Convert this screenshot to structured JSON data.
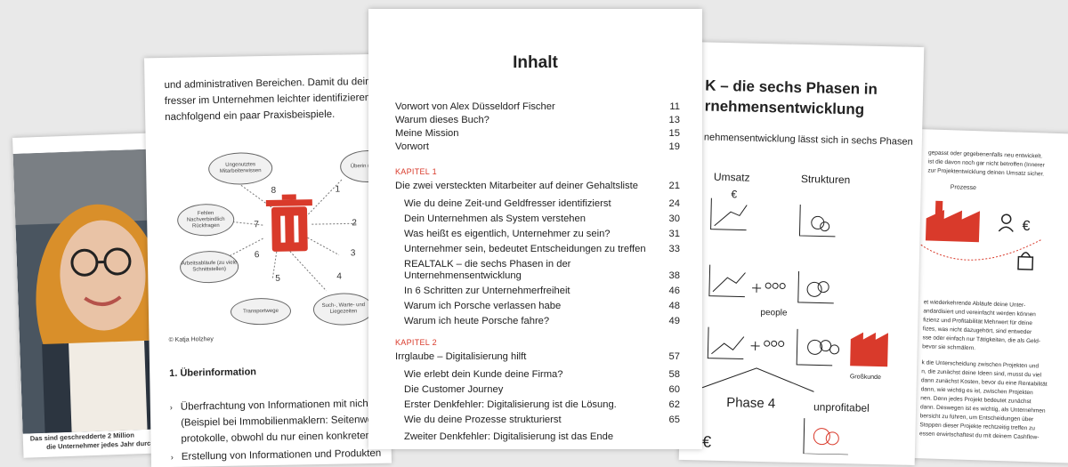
{
  "page1": {
    "caption_line1": "Das sind geschredderte 2 Million",
    "caption_line2": "die Unternehmer jedes Jahr durch"
  },
  "page2": {
    "intro_lines": [
      "und administrativen Bereichen. Damit du dein",
      "fresser im Unternehmen leichter identifizieren",
      "nachfolgend ein paar Praxisbeispiele."
    ],
    "credit": "© Katja Holzhey",
    "section_heading": "1. Überinformation",
    "bullet1_lines": [
      "Überfrachtung von Informationen mit nicht b",
      "(Beispiel bei Immobilienmaklern: Seitenweis",
      "protokolle, obwohl du nur einen konkreten B"
    ],
    "bullet2": "Erstellung von Informationen und Produkten",
    "diagram_numbers": [
      "1",
      "2",
      "3",
      "4",
      "5",
      "6",
      "7",
      "8"
    ],
    "ovals": [
      "Ungenutztes Mitarbeiterwissen",
      "Überin (z.B. gr",
      "Fehlen Nachverbindlich Rückfragen",
      "Arbeitsabläufe (zu viele Schnittstellen)",
      "Transportwege",
      "Such-, Warte- und Liegezeiten"
    ]
  },
  "toc": {
    "title": "Inhalt",
    "front": [
      {
        "label": "Vorwort von Alex Düsseldorf Fischer",
        "page": "11"
      },
      {
        "label": "Warum dieses Buch?",
        "page": "13"
      },
      {
        "label": "Meine Mission",
        "page": "15"
      },
      {
        "label": "Vorwort",
        "page": "19"
      }
    ],
    "k1_label": "KAPITEL 1",
    "k1_title": {
      "label": "Die zwei versteckten Mitarbeiter auf deiner Gehaltsliste",
      "page": "21"
    },
    "k1_items": [
      {
        "label": "Wie du deine Zeit-und Geldfresser identifizierst",
        "page": "24"
      },
      {
        "label": "Dein Unternehmen als System verstehen",
        "page": "30"
      },
      {
        "label": "Was heißt es eigentlich, Unternehmer zu sein?",
        "page": "31"
      },
      {
        "label": "Unternehmer sein, bedeutet Entscheidungen zu treffen",
        "page": "33"
      },
      {
        "label": "REALTALK – die sechs Phasen in der",
        "page": ""
      },
      {
        "label": "Unternehmensentwicklung",
        "page": "38"
      },
      {
        "label": "In 6 Schritten zur Unternehmerfreiheit",
        "page": "46"
      },
      {
        "label": "Warum ich Porsche verlassen habe",
        "page": "48"
      },
      {
        "label": "Warum ich heute Porsche fahre?",
        "page": "49"
      }
    ],
    "k2_label": "KAPITEL 2",
    "k2_title": {
      "label": "Irrglaube – Digitalisierung hilft",
      "page": "57"
    },
    "k2_items": [
      {
        "label": "Wie erlebt dein Kunde deine Firma?",
        "page": "58"
      },
      {
        "label": "Die Customer Journey",
        "page": "60"
      },
      {
        "label": "Erster Denkfehler: Digitalisierung ist die Lösung.",
        "page": "62"
      },
      {
        "label": "Wie du deine Prozesse strukturierst",
        "page": "65"
      },
      {
        "label": "Zweiter Denkfehler: Digitalisierung ist das Ende",
        "page": ""
      }
    ]
  },
  "page4": {
    "heading_line1": "K – die sechs Phasen in",
    "heading_line2": "rnehmensentwicklung",
    "subtext": "nehmensentwicklung lässt sich in sechs Phasen",
    "labels": {
      "umsatz": "Umsatz",
      "strukturen": "Strukturen",
      "people": "people",
      "phase": "Phase 4",
      "unprofitabel": "unprofitabel",
      "grosskunde": "Großkunde",
      "euro": "€"
    }
  },
  "page5": {
    "top_lines": [
      "gepasst oder gegebenenfalls neu entwickelt.",
      "ist die davon noch gar nicht betroffen (Innerer",
      "zur Projektentwicklung deinen Umsatz sicher."
    ],
    "prozesse": "Prozesse",
    "mid_lines": [
      "et wiederkehrende Abläufe deine Unter-",
      "andardisiert und vereinfacht werden können",
      "fizienz und Profitabilität Mehrwert für deine",
      "fizes, was nicht dazugehört, sind entweder",
      "sse oder einfach nur Tätigkeiten, die als Geld-",
      "bevor sie schmälern."
    ],
    "bottom_lines": [
      "k die Unterscheidung zwischen Projekten und",
      "n, die zunächst deine Ideen sind, musst du viel",
      "dann zunächst Kosten, bevor du eine Rentabilität",
      "dann, wie wichtig es ist, zwischen Projekten",
      "nen. Denn jedes Projekt bedeutet zunächst",
      "dann. Deswegen ist es wichtig, als Unternehmen",
      "bersicht zu führen, um Entscheidungen über",
      "Stoppen dieser Projekte rechtzeitig treffen zu",
      "essen erwirtschaftest du mit deinem Cashflow-"
    ]
  }
}
